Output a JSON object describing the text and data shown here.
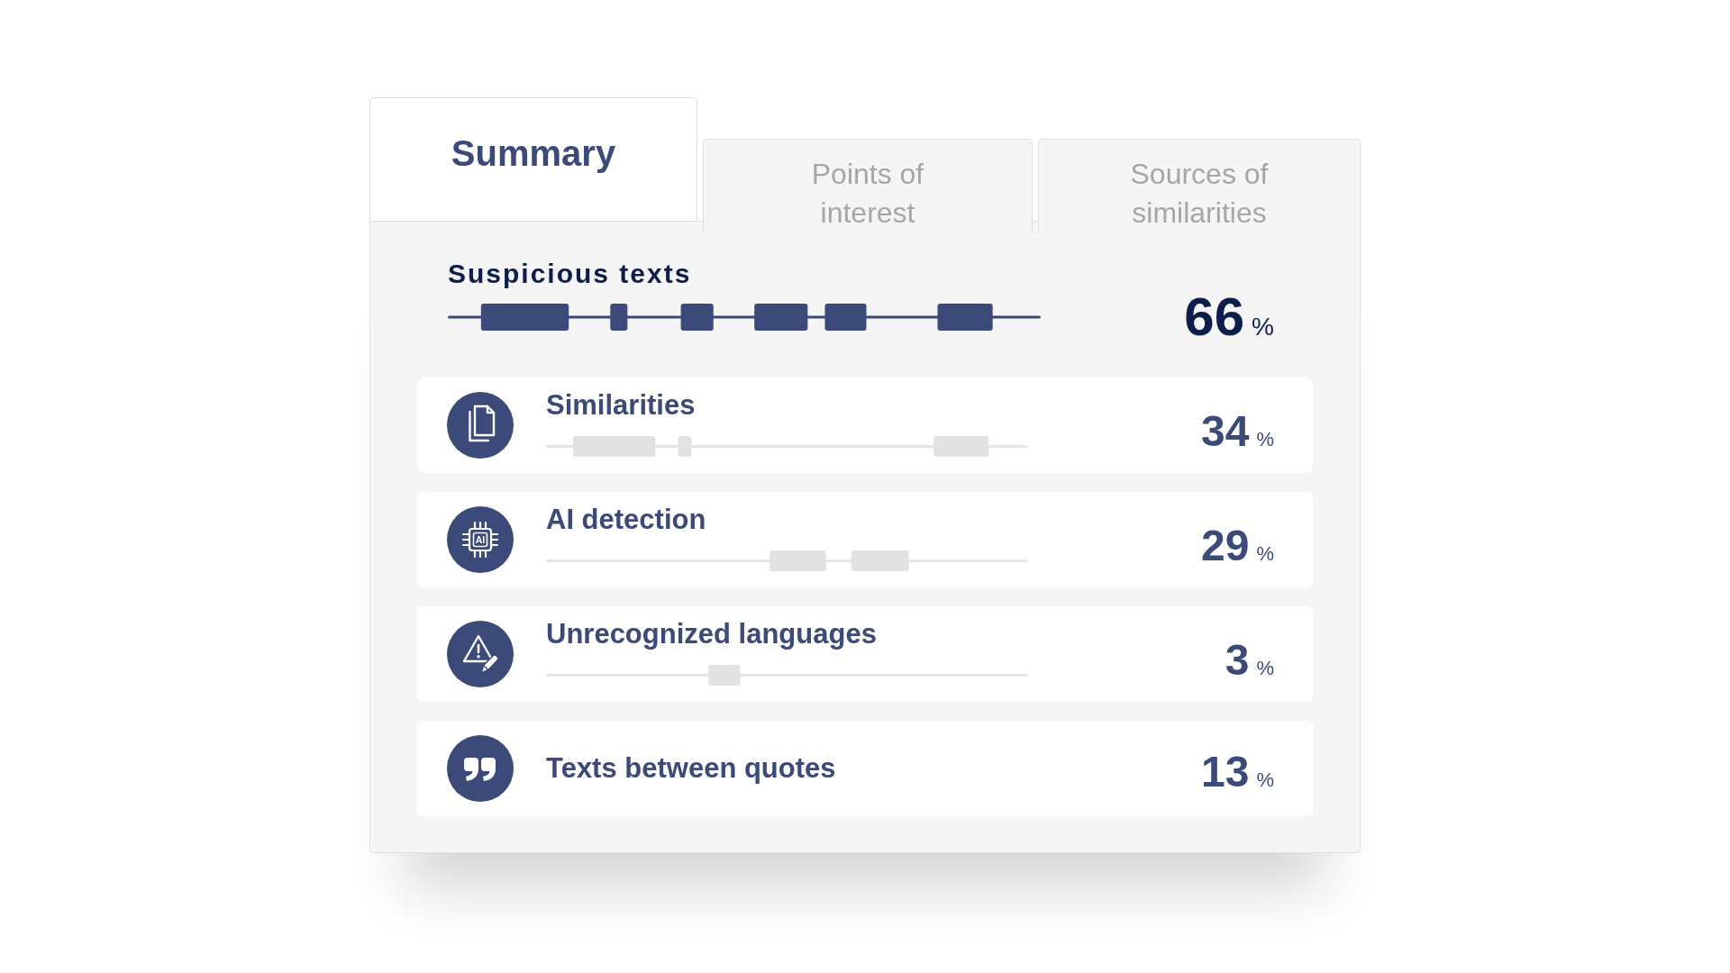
{
  "tabs": [
    {
      "label": "Summary",
      "selected": true
    },
    {
      "label": "Points of interest",
      "selected": false
    },
    {
      "label": "Sources of similarities",
      "selected": false
    }
  ],
  "summary": {
    "title": "Suspicious texts",
    "value": "66",
    "unit": "%"
  },
  "categories": [
    {
      "kind": "similarity",
      "title": "Similarities",
      "value": "34",
      "unit": "%"
    },
    {
      "kind": "ai",
      "title": "AI detection",
      "icon_text": "AI",
      "value": "29",
      "unit": "%"
    },
    {
      "kind": "language",
      "title": "Unrecognized languages",
      "value": "3",
      "unit": "%"
    },
    {
      "kind": "quote",
      "title": "Texts between quotes",
      "value": "13",
      "unit": "%"
    }
  ]
}
